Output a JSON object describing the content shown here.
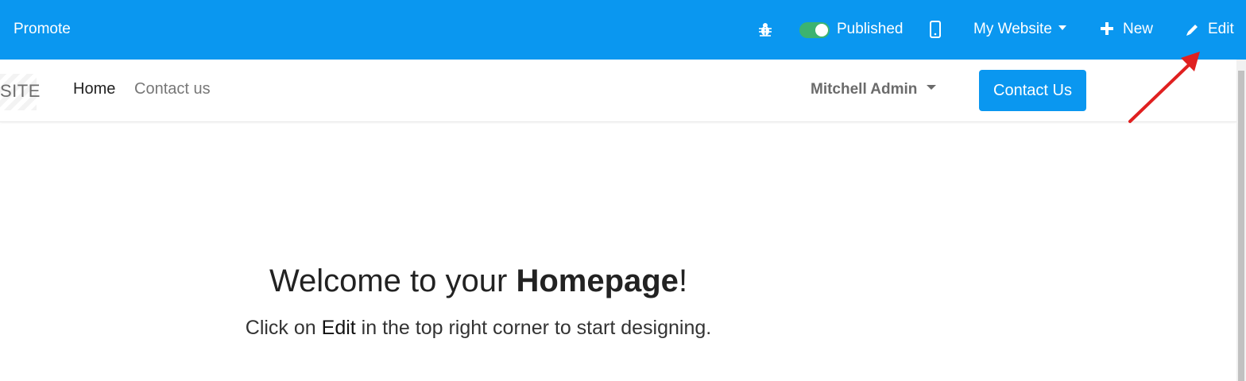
{
  "topbar": {
    "promote": "Promote",
    "published_label": "Published",
    "website_selector": "My Website",
    "new_label": "New",
    "edit_label": "Edit",
    "published": true,
    "icons": [
      "bug-icon",
      "mobile-phone-icon",
      "plus-icon",
      "pencil-icon"
    ]
  },
  "site_header": {
    "logo_text": "SITE",
    "nav": [
      "Home",
      "Contact us"
    ],
    "user_menu": "Mitchell Admin",
    "cta": "Contact Us"
  },
  "main": {
    "welcome_prefix": "Welcome to your ",
    "welcome_bold": "Homepage",
    "welcome_suffix": "!",
    "sub_prefix": "Click on ",
    "sub_bold": "Edit",
    "sub_suffix": " in the top right corner to start designing."
  },
  "colors": {
    "accent": "#0a97f0",
    "toggle_on": "#3cb371",
    "annotation_arrow": "#e02020"
  }
}
